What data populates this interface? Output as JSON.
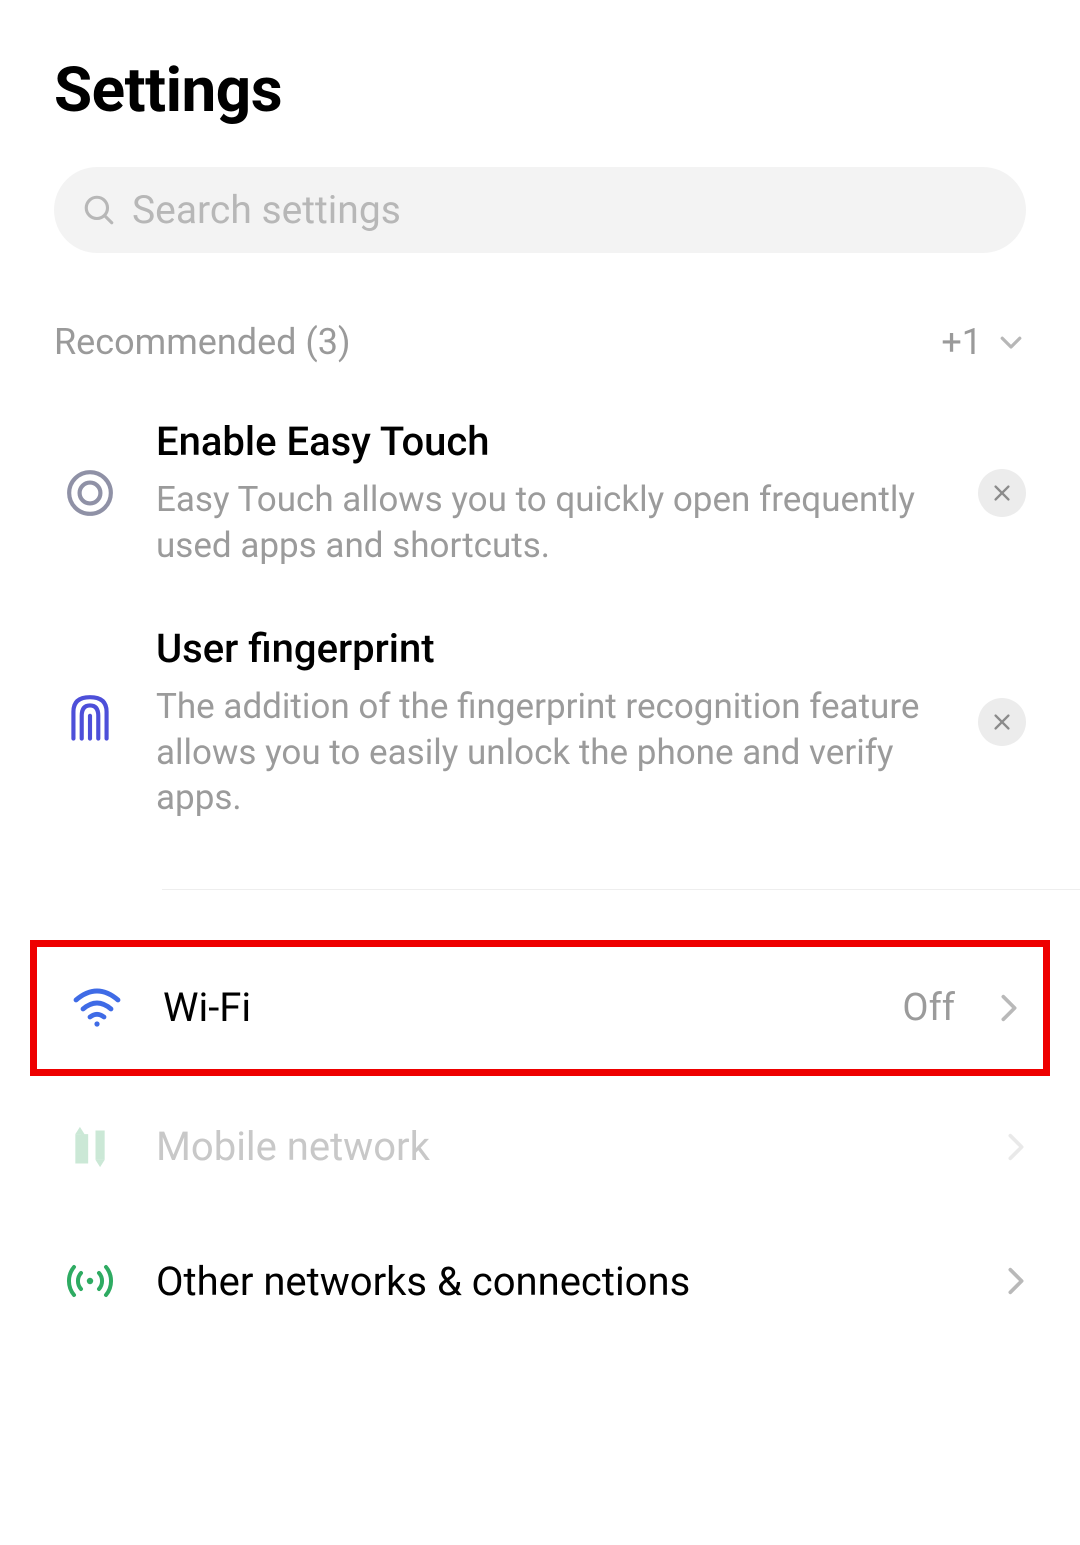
{
  "title": "Settings",
  "search": {
    "placeholder": "Search settings"
  },
  "recommended": {
    "header_label": "Recommended (3)",
    "more_label": "+1",
    "items": [
      {
        "title": "Enable Easy Touch",
        "desc": "Easy Touch allows you to quickly open frequently used apps and shortcuts."
      },
      {
        "title": "User fingerprint",
        "desc": "The addition of the fingerprint recognition feature allows you to easily unlock the phone and verify apps."
      }
    ]
  },
  "menu": {
    "wifi": {
      "label": "Wi-Fi",
      "value": "Off"
    },
    "mobile": {
      "label": "Mobile network"
    },
    "other": {
      "label": "Other networks & connections"
    }
  }
}
